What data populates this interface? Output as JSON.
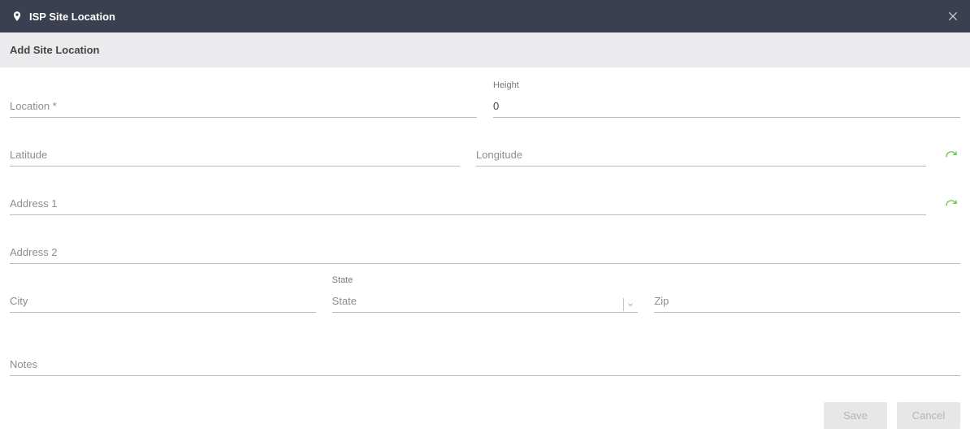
{
  "titlebar": {
    "title": "ISP Site Location"
  },
  "subheader": "Add Site Location",
  "fields": {
    "location": {
      "placeholder": "Location *",
      "value": ""
    },
    "height": {
      "label": "Height",
      "value": "0"
    },
    "latitude": {
      "placeholder": "Latitude",
      "value": ""
    },
    "longitude": {
      "placeholder": "Longitude",
      "value": ""
    },
    "address1": {
      "placeholder": "Address 1",
      "value": ""
    },
    "address2": {
      "placeholder": "Address 2",
      "value": ""
    },
    "city": {
      "placeholder": "City",
      "value": ""
    },
    "state": {
      "label": "State",
      "placeholder": "State",
      "value": ""
    },
    "zip": {
      "placeholder": "Zip",
      "value": ""
    },
    "notes": {
      "placeholder": "Notes",
      "value": ""
    }
  },
  "actions": {
    "save": "Save",
    "cancel": "Cancel"
  }
}
